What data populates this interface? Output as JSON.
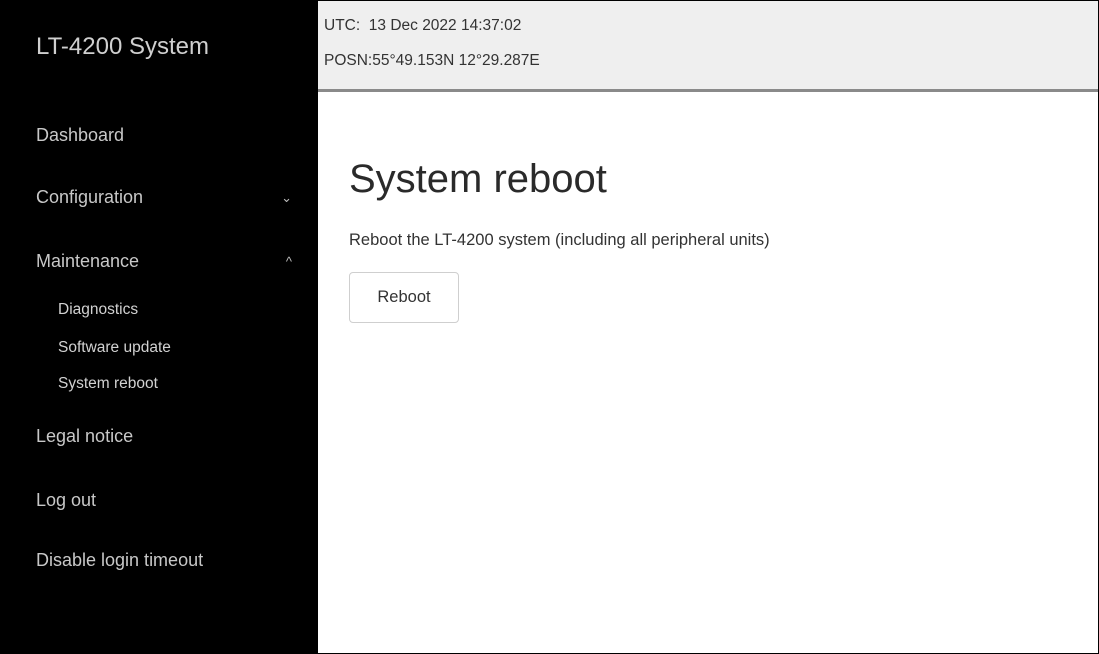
{
  "sidebar": {
    "brand": "LT-4200 System",
    "items": [
      {
        "label": "Dashboard"
      },
      {
        "label": "Configuration",
        "chevron": "⌄"
      },
      {
        "label": "Maintenance",
        "chevron": "^"
      },
      {
        "label": "Legal notice"
      },
      {
        "label": "Log out"
      },
      {
        "label": "Disable login timeout"
      }
    ],
    "maintenance_sub": [
      {
        "label": "Diagnostics"
      },
      {
        "label": "Software update"
      },
      {
        "label": "System reboot"
      }
    ],
    "colors": {
      "background": "#000000",
      "text": "#c8c8c8"
    }
  },
  "header": {
    "utc_line": "UTC:  13 Dec 2022 14:37:02",
    "posn_line": "POSN:55°49.153N 12°29.287E",
    "colors": {
      "background": "#efefef",
      "border": "#8a8a8a"
    }
  },
  "main": {
    "title": "System reboot",
    "description": "Reboot the LT-4200 system (including all peripheral units)",
    "reboot_button": "Reboot"
  }
}
